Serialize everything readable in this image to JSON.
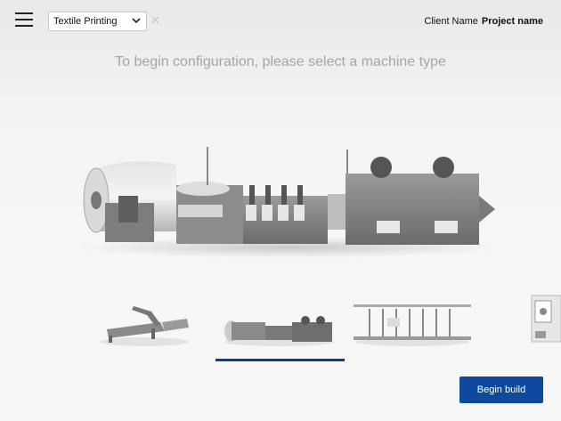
{
  "header": {
    "machine_category": "Textile Printing",
    "client_name": "Client Name",
    "project_name": "Project name"
  },
  "icons": [
    "menu-icon",
    "chevron-down-icon",
    "close-icon"
  ],
  "main": {
    "prompt": "To begin configuration, please select a machine type"
  },
  "footer": {
    "begin_label": "Begin build"
  },
  "colors": {
    "accent": "#0d4a9e",
    "active_indicator": "#103e8c",
    "prompt_text": "#a6a6a6"
  }
}
